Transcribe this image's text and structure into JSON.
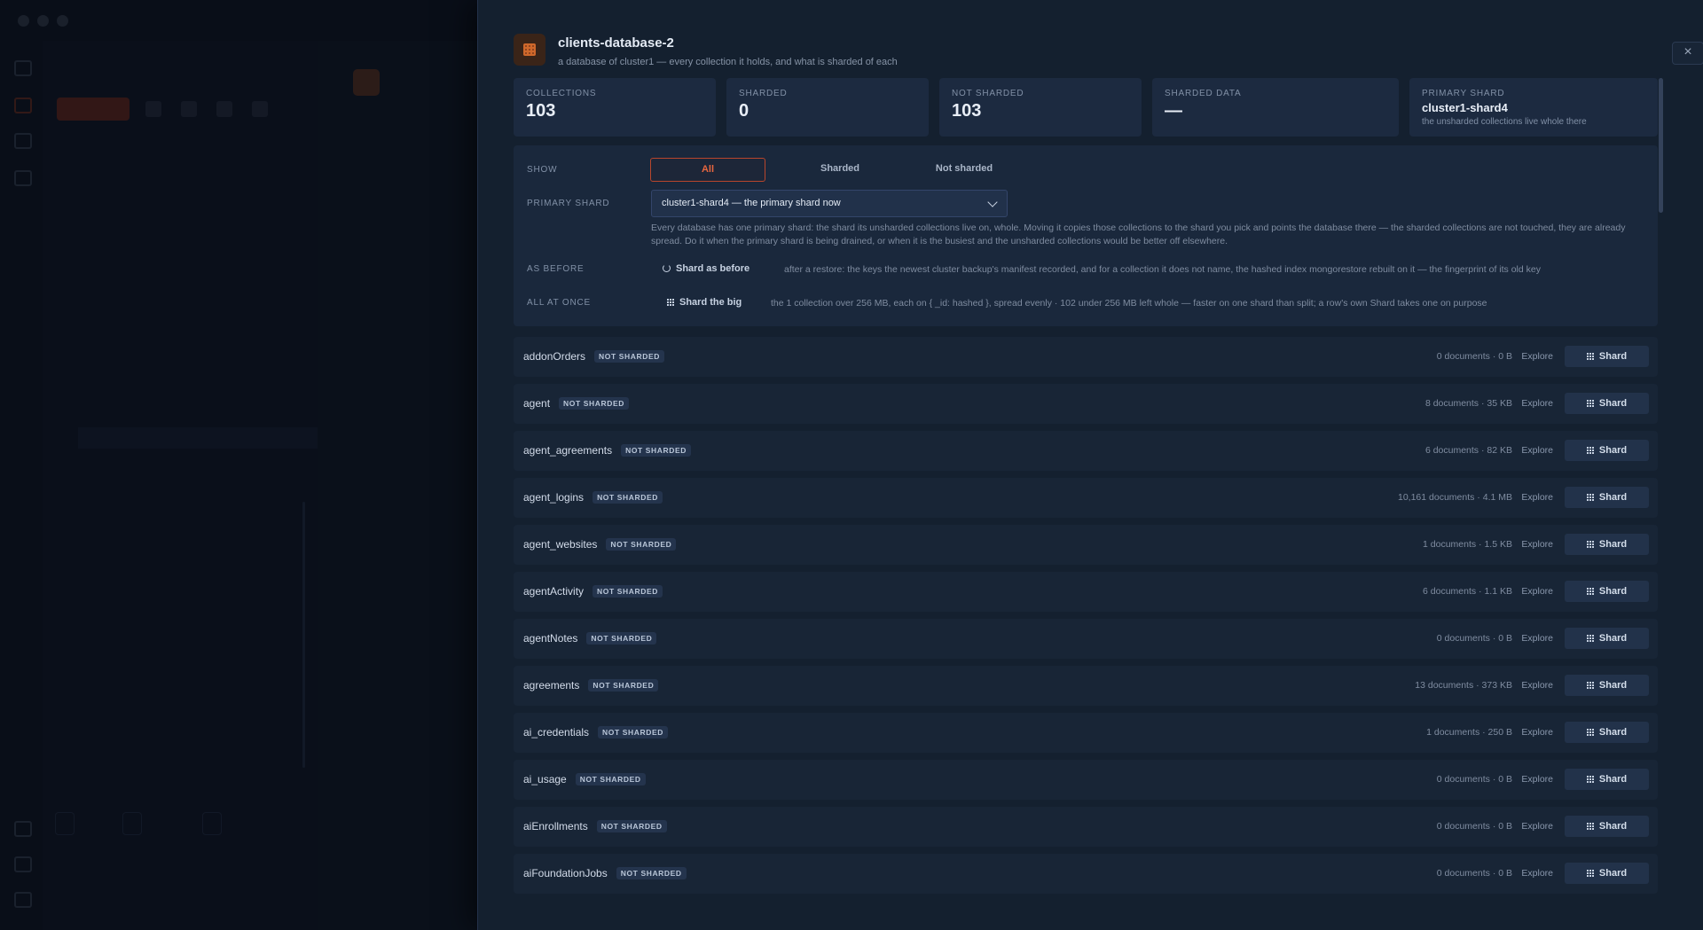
{
  "modal": {
    "title": "clients-database-2",
    "subtitle": "a database of cluster1 — every collection it holds, and what is sharded of each",
    "close": "×"
  },
  "stats": [
    {
      "label": "COLLECTIONS",
      "value": "103"
    },
    {
      "label": "SHARDED",
      "value": "0"
    },
    {
      "label": "NOT SHARDED",
      "value": "103"
    },
    {
      "label": "SHARDED DATA",
      "value": "—"
    },
    {
      "label": "PRIMARY SHARD",
      "value": "cluster1-shard4",
      "note": "the unsharded collections live whole there"
    }
  ],
  "controls": {
    "show_label": "SHOW",
    "show_options": [
      "All",
      "Sharded",
      "Not sharded"
    ],
    "show_selected": "All",
    "primary_label": "PRIMARY SHARD",
    "primary_value": "cluster1-shard4 — the primary shard now",
    "help": "Every database has one primary shard: the shard its unsharded collections live on, whole. Moving it copies those collections to the shard you pick and points the database there — the sharded collections are not touched, they are already spread. Do it when the primary shard is being drained, or when it is the busiest and the unsharded collections would be better off elsewhere.",
    "as_before_label": "AS BEFORE",
    "as_before_button": "Shard as before",
    "as_before_desc": "after a restore: the keys the newest cluster backup's manifest recorded, and for a collection it does not name, the hashed index mongorestore rebuilt on it — the fingerprint of its old key",
    "all_at_once_label": "ALL AT ONCE",
    "all_at_once_button": "Shard the big",
    "all_at_once_desc": "the 1 collection over 256 MB, each on { _id: hashed }, spread evenly · 102 under 256 MB left whole — faster on one shard than split; a row's own Shard takes one on purpose"
  },
  "row_labels": {
    "badge": "NOT SHARDED",
    "explore": "Explore",
    "shard": "Shard"
  },
  "collections": [
    {
      "name": "addonOrders",
      "meta": "0 documents · 0 B"
    },
    {
      "name": "agent",
      "meta": "8 documents · 35 KB"
    },
    {
      "name": "agent_agreements",
      "meta": "6 documents · 82 KB"
    },
    {
      "name": "agent_logins",
      "meta": "10,161 documents · 4.1 MB"
    },
    {
      "name": "agent_websites",
      "meta": "1 documents · 1.5 KB"
    },
    {
      "name": "agentActivity",
      "meta": "6 documents · 1.1 KB"
    },
    {
      "name": "agentNotes",
      "meta": "0 documents · 0 B"
    },
    {
      "name": "agreements",
      "meta": "13 documents · 373 KB"
    },
    {
      "name": "ai_credentials",
      "meta": "1 documents · 250 B"
    },
    {
      "name": "ai_usage",
      "meta": "0 documents · 0 B"
    },
    {
      "name": "aiEnrollments",
      "meta": "0 documents · 0 B"
    },
    {
      "name": "aiFoundationJobs",
      "meta": "0 documents · 0 B"
    }
  ],
  "colors": {
    "accent": "#e9673f",
    "panel": "#14202f"
  },
  "icons": [
    "database-icon",
    "close-icon",
    "chevron-down-icon",
    "restore-icon",
    "grid-icon"
  ]
}
